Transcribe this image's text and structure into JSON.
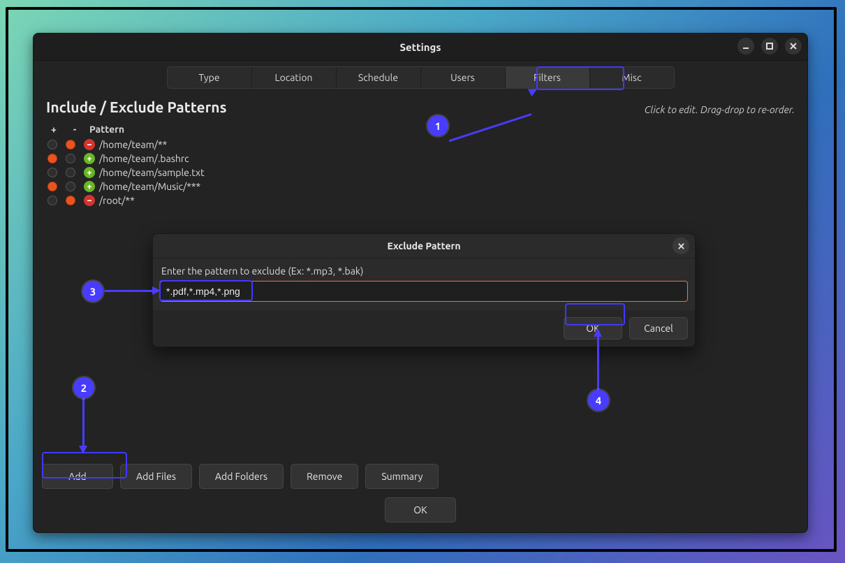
{
  "window": {
    "title": "Settings"
  },
  "tabs": {
    "items": [
      "Type",
      "Location",
      "Schedule",
      "Users",
      "Filters",
      "Misc"
    ],
    "active_index": 4
  },
  "section": {
    "title": "Include / Exclude Patterns",
    "hint": "Click to edit. Drag-drop to re-order."
  },
  "columns": {
    "plus": "+",
    "minus": "-",
    "pattern": "Pattern"
  },
  "rows": [
    {
      "plus_on": false,
      "minus_on": true,
      "sign": "-",
      "path": "/home/team/**"
    },
    {
      "plus_on": true,
      "minus_on": false,
      "sign": "+",
      "path": "/home/team/.bashrc"
    },
    {
      "plus_on": false,
      "minus_on": false,
      "sign": "+",
      "path": "/home/team/sample.txt"
    },
    {
      "plus_on": true,
      "minus_on": false,
      "sign": "+",
      "path": "/home/team/Music/***"
    },
    {
      "plus_on": false,
      "minus_on": true,
      "sign": "-",
      "path": "/root/**"
    }
  ],
  "actions": {
    "add": "Add",
    "add_files": "Add Files",
    "add_folders": "Add Folders",
    "remove": "Remove",
    "summary": "Summary",
    "ok": "OK"
  },
  "dialog": {
    "title": "Exclude Pattern",
    "label": "Enter the pattern to exclude (Ex: *.mp3, *.bak)",
    "value": "*.pdf,*.mp4,*.png",
    "ok": "OK",
    "cancel": "Cancel"
  },
  "annotations": {
    "1": "1",
    "2": "2",
    "3": "3",
    "4": "4"
  }
}
